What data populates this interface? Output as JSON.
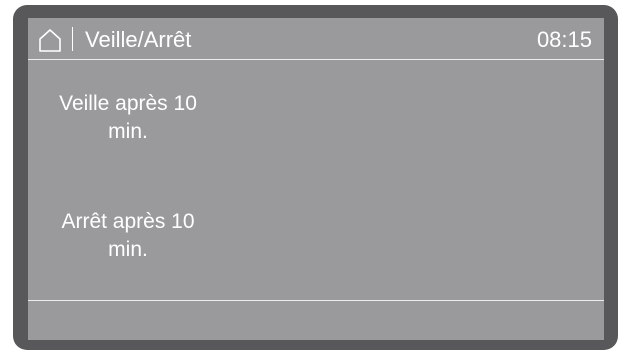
{
  "header": {
    "home_icon": "home-icon",
    "title": "Veille/Arrêt",
    "time": "08:15"
  },
  "options": [
    {
      "line1": "Veille après 10",
      "line2": "min."
    },
    {
      "line1": "Arrêt après 10",
      "line2": "min."
    }
  ],
  "colors": {
    "bezel": "#58585a",
    "screen": "#9a9a9c",
    "text": "#ffffff"
  }
}
